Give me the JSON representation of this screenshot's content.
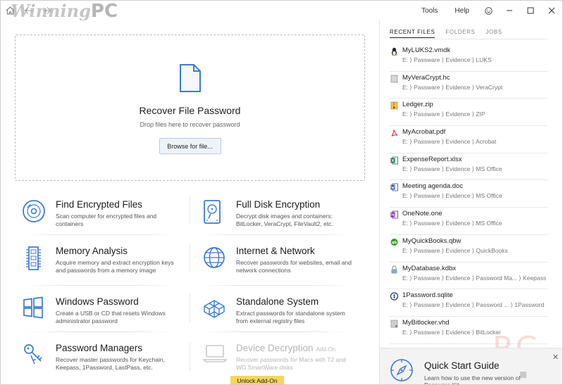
{
  "titlebar": {
    "watermark_text": "Winning",
    "watermark_pc": "PC",
    "menu": {
      "tools": "Tools",
      "help": "Help"
    }
  },
  "dropzone": {
    "title": "Recover File Password",
    "subtitle": "Drop files here to recover password",
    "browse_label": "Browse for file..."
  },
  "tiles": [
    {
      "title": "Find Encrypted Files",
      "desc": "Scan computer for encrypted files and containers",
      "icon": "disc-icon"
    },
    {
      "title": "Full Disk Encryption",
      "desc": "Decrypt disk images and containers: BitLocker, VeraCrypt, FileVault2, etc.",
      "icon": "hard-drive-icon"
    },
    {
      "title": "Memory Analysis",
      "desc": "Acquire memory and extract encryption keys and passwords from a memory image",
      "icon": "memory-chip-icon"
    },
    {
      "title": "Internet & Network",
      "desc": "Recover passwords for websites, email and network connections",
      "icon": "globe-icon"
    },
    {
      "title": "Windows Password",
      "desc": "Create a USB or CD that resets Windows administrator password",
      "icon": "windows-icon"
    },
    {
      "title": "Standalone System",
      "desc": "Extract passwords for standalone system from external registry files",
      "icon": "cubes-icon"
    },
    {
      "title": "Password Managers",
      "desc": "Recover master passwords for Keychain, Keepass, 1Password, LastPass, etc.",
      "icon": "keys-icon"
    },
    {
      "title": "Device Decryption",
      "addon": "Add-On",
      "desc": "Recover passwords for Macs with T2 and WD SmartWare disks",
      "icon": "laptop-icon",
      "unlock_label": "Unlock Add-On"
    }
  ],
  "side": {
    "tabs": [
      "RECENT FILES",
      "FOLDERS",
      "JOBS"
    ],
    "active_tab": 0,
    "files": [
      {
        "name": "MyLUKS2.vmdk",
        "path": "E: ⟩ Passware ⟩ Evidence ⟩ LUKS",
        "icon": "linux-icon"
      },
      {
        "name": "MyVeraCrypt.hc",
        "path": "E: ⟩ Passware ⟩ Evidence ⟩ VeraCrypt",
        "icon": "container-icon"
      },
      {
        "name": "Ledger.zip",
        "path": "E: ⟩ Passware ⟩ Evidence ⟩ ZIP",
        "icon": "zip-icon"
      },
      {
        "name": "MyAcrobat.pdf",
        "path": "E: ⟩ Passware ⟩ Evidence ⟩ Acrobat",
        "icon": "pdf-icon"
      },
      {
        "name": "ExpenseReport.xlsx",
        "path": "E: ⟩ Passware ⟩ Evidence ⟩ MS Office",
        "icon": "excel-icon"
      },
      {
        "name": "Meeting agenda.doc",
        "path": "E: ⟩ Passware ⟩ Evidence ⟩ MS Office",
        "icon": "word-icon"
      },
      {
        "name": "OneNote.one",
        "path": "E: ⟩ Passware ⟩ Evidence ⟩ MS Office",
        "icon": "onenote-icon"
      },
      {
        "name": "MyQuickBooks.qbw",
        "path": "E: ⟩ Passware ⟩ Evidence ⟩ QuickBooks",
        "icon": "quickbooks-icon"
      },
      {
        "name": "MyDatabase.kdbx",
        "path": "E: ⟩ Passware ⟩ Evidence ⟩ Password Ma... ⟩ Keepass",
        "icon": "lock-icon"
      },
      {
        "name": "1Password.sqlite",
        "path": "E: ⟩ Passware ⟩ Evidence ⟩ Password ... ⟩ 1Password",
        "icon": "onepassword-icon"
      },
      {
        "name": "MyBitlocker.vhd",
        "path": "E: ⟩ Passware ⟩ Evidence ⟩ BitLocker",
        "icon": "disk-image-icon"
      }
    ],
    "quickstart": {
      "title": "Quick Start Guide",
      "subtitle": "Learn how to use the new version of Passware Kit"
    },
    "watermark": "PC"
  }
}
